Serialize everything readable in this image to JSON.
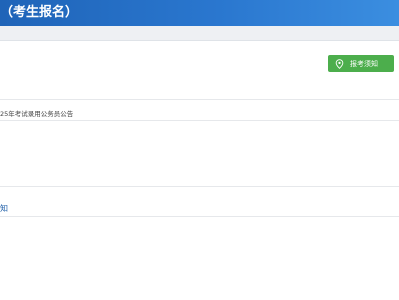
{
  "header": {
    "title": "（考生报名）"
  },
  "notice_button": {
    "label": "报考须知",
    "icon": "location-pin-icon",
    "color": "#4cae4c"
  },
  "announcement": {
    "text": "25年考试录用公务员公告"
  },
  "notice_link": {
    "text": "知"
  },
  "colors": {
    "header_blue": "#2a77cf",
    "link_blue": "#1f5fa8"
  }
}
